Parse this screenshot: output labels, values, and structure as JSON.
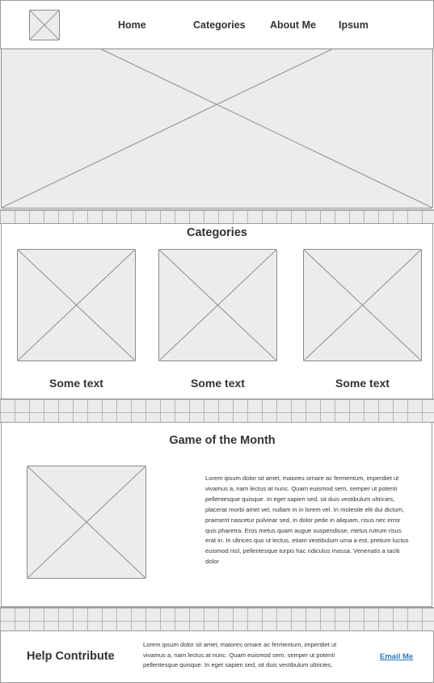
{
  "nav": {
    "logo_icon": "image-placeholder-icon",
    "items": [
      "Home",
      "Categories",
      "About Me",
      "Ipsum"
    ]
  },
  "hero": {
    "icon": "image-placeholder-icon"
  },
  "categories": {
    "title": "Categories",
    "cards": [
      {
        "caption": "Some text"
      },
      {
        "caption": "Some text"
      },
      {
        "caption": "Some text"
      }
    ]
  },
  "game_of_month": {
    "title": "Game of the Month",
    "body": "Lorem ipsum dolor sit amet, maiores ornare ac fermentum, imperdiet ut vivamus a, nam lectus at nunc. Quam euismod sem, semper ut potenti pellentesque quisque. In eget sapien sed, sit duis vestibulum ultricies, placerat morbi amet vel, nullam in in lorem vel. In molestie elit dui dictum, praesent nascetur pulvinar sed, in dolor pede in aliquam, risus nec error quis pharetra. Eros metus quam augue suspendisse, metus rutrum risus erat in.  In ultrices quo ut lectus, etiam vestibulum urna a est, pretium luctus euismod nisl, pellentesque turpis hac ridiculus massa. Venenatis a taciti dolor"
  },
  "footer": {
    "title": "Help Contribute",
    "body": "Lorem ipsum dolor sit amet, maiores ornare ac fermentum, imperdiet ut vivamus a, nam lectus at nunc. Quam euismod sem, semper ut potenti pellentesque quisque. In eget sapien sed, sit duis vestibulum ultricies,",
    "email_label": "Email Me"
  }
}
